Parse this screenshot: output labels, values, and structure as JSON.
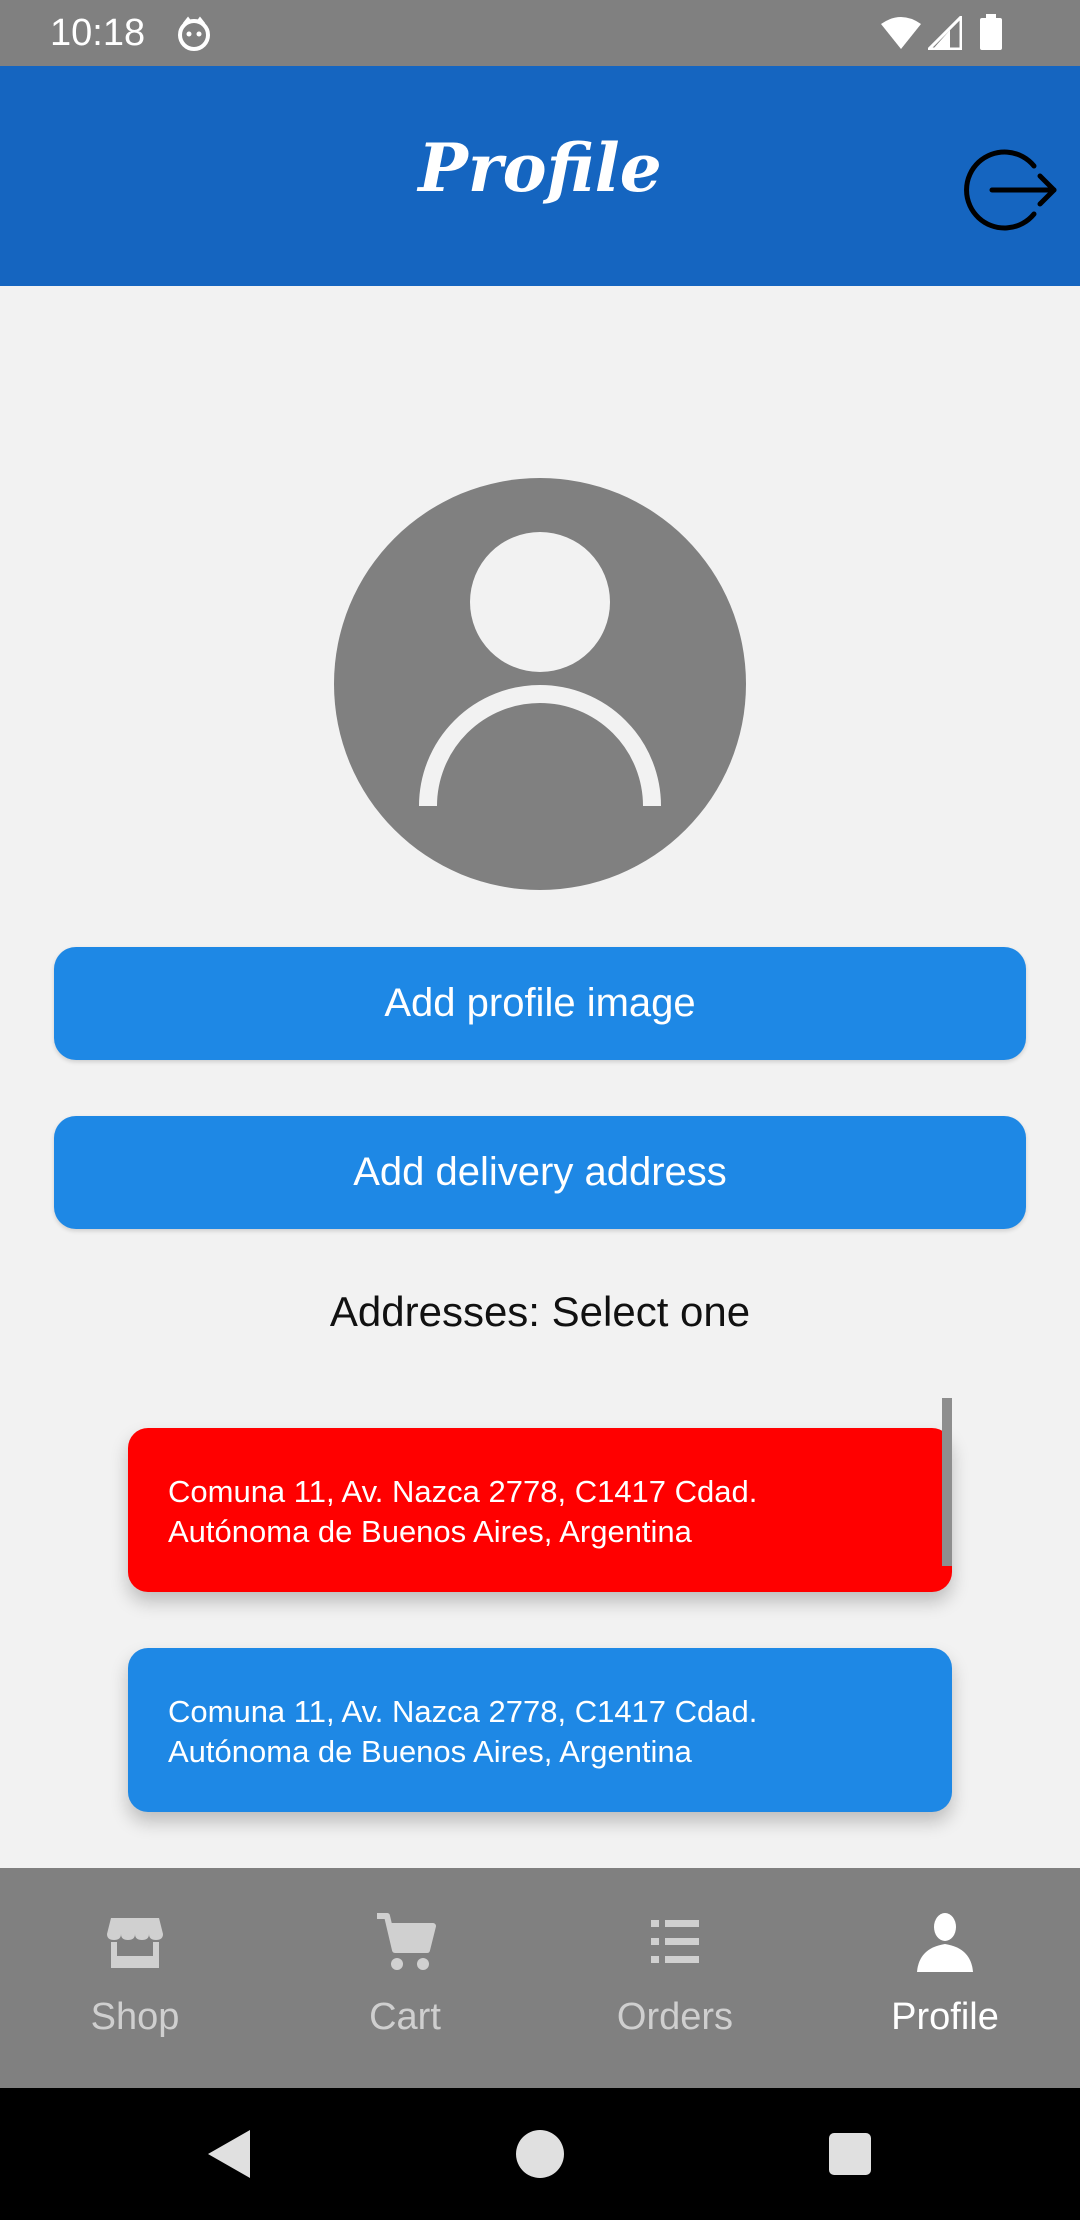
{
  "status_bar": {
    "time": "10:18",
    "icons": [
      "notification-app-icon",
      "wifi-icon",
      "signal-icon",
      "battery-icon"
    ]
  },
  "app_bar": {
    "title": "Profile",
    "logout_icon": "logout-icon"
  },
  "profile": {
    "avatar_icon": "default-avatar-icon",
    "add_image_label": "Add profile image",
    "add_address_label": "Add delivery address",
    "addresses_heading": "Addresses: Select one"
  },
  "addresses": [
    {
      "line1": "Comuna 11, Av. Nazca 2778, C1417 Cdad.",
      "line2": "Autónoma de Buenos Aires, Argentina",
      "selected": true
    },
    {
      "line1": "Comuna 11, Av. Nazca 2778, C1417 Cdad.",
      "line2": "Autónoma de Buenos Aires, Argentina",
      "selected": false
    }
  ],
  "bottom_nav": {
    "items": [
      {
        "label": "Shop",
        "icon": "store-icon",
        "active": false
      },
      {
        "label": "Cart",
        "icon": "cart-icon",
        "active": false
      },
      {
        "label": "Orders",
        "icon": "list-icon",
        "active": false
      },
      {
        "label": "Profile",
        "icon": "person-icon",
        "active": true
      }
    ]
  },
  "colors": {
    "app_bar": "#1565c0",
    "primary_button": "#1e88e5",
    "selected_address": "#ff0000",
    "background": "#f2f2f2",
    "nav_background": "#808080"
  }
}
